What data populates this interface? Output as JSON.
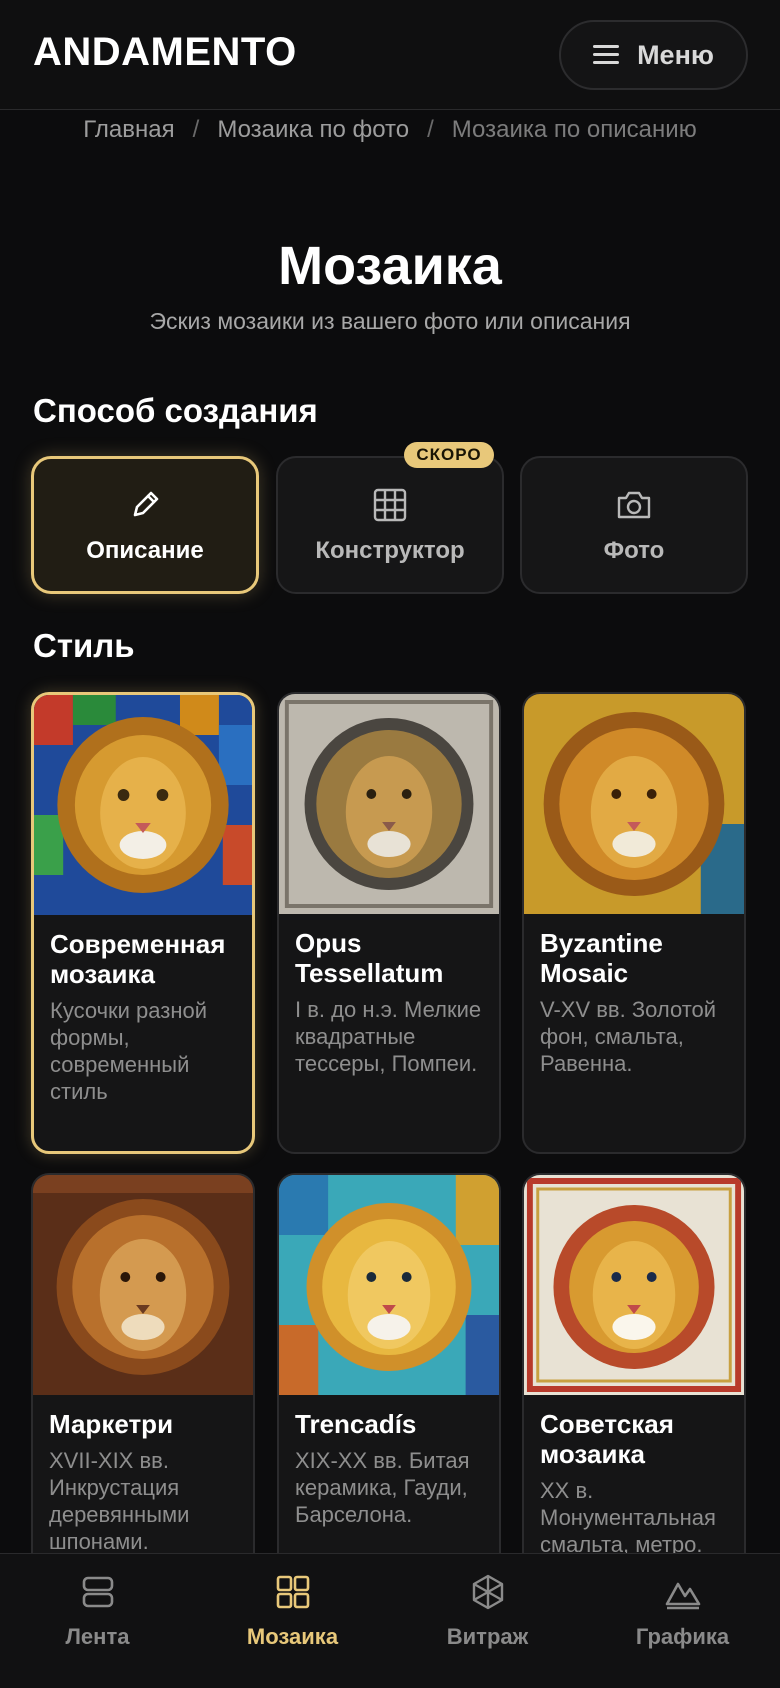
{
  "header": {
    "logo": "ANDAMENTO",
    "menu_label": "Меню"
  },
  "breadcrumb": [
    "Главная",
    "Мозаика по фото",
    "Мозаика по описанию"
  ],
  "page": {
    "title": "Мозаика",
    "subtitle": "Эскиз мозаики из вашего фото или описания"
  },
  "method": {
    "title": "Способ создания",
    "soon_badge": "СКОРО",
    "options": [
      {
        "label": "Описание",
        "icon": "pencil-icon",
        "selected": true
      },
      {
        "label": "Конструктор",
        "icon": "grid-icon",
        "selected": false
      },
      {
        "label": "Фото",
        "icon": "camera-icon",
        "selected": false
      }
    ]
  },
  "style": {
    "title": "Стиль",
    "cards": [
      {
        "title": "Современная мозаика",
        "desc": "Кусочки разной формы, современный стиль",
        "selected": true
      },
      {
        "title": "Opus Tessellatum",
        "desc": "I в. до н.э. Мелкие квадратные тессеры, Помпеи.",
        "selected": false
      },
      {
        "title": "Byzantine Mosaic",
        "desc": "V-XV вв. Золотой фон, смальта, Равенна.",
        "selected": false
      },
      {
        "title": "Маркетри",
        "desc": "XVII-XIX вв. Инкрустация деревянными шпонами.",
        "selected": false
      },
      {
        "title": "Trencadís",
        "desc": "XIX-XX вв. Битая керамика, Гауди, Барселона.",
        "selected": false
      },
      {
        "title": "Советская мозаика",
        "desc": "XX в. Монументальная смальта, метро.",
        "selected": false
      }
    ]
  },
  "nav": [
    {
      "label": "Лента",
      "icon": "feed-icon",
      "active": false
    },
    {
      "label": "Мозаика",
      "icon": "mosaic-grid-icon",
      "active": true
    },
    {
      "label": "Витраж",
      "icon": "stained-glass-icon",
      "active": false
    },
    {
      "label": "Графика",
      "icon": "mountain-icon",
      "active": false
    }
  ],
  "colors": {
    "accent": "#e8c87a",
    "background": "#0c0c0d",
    "card": "#151516"
  }
}
